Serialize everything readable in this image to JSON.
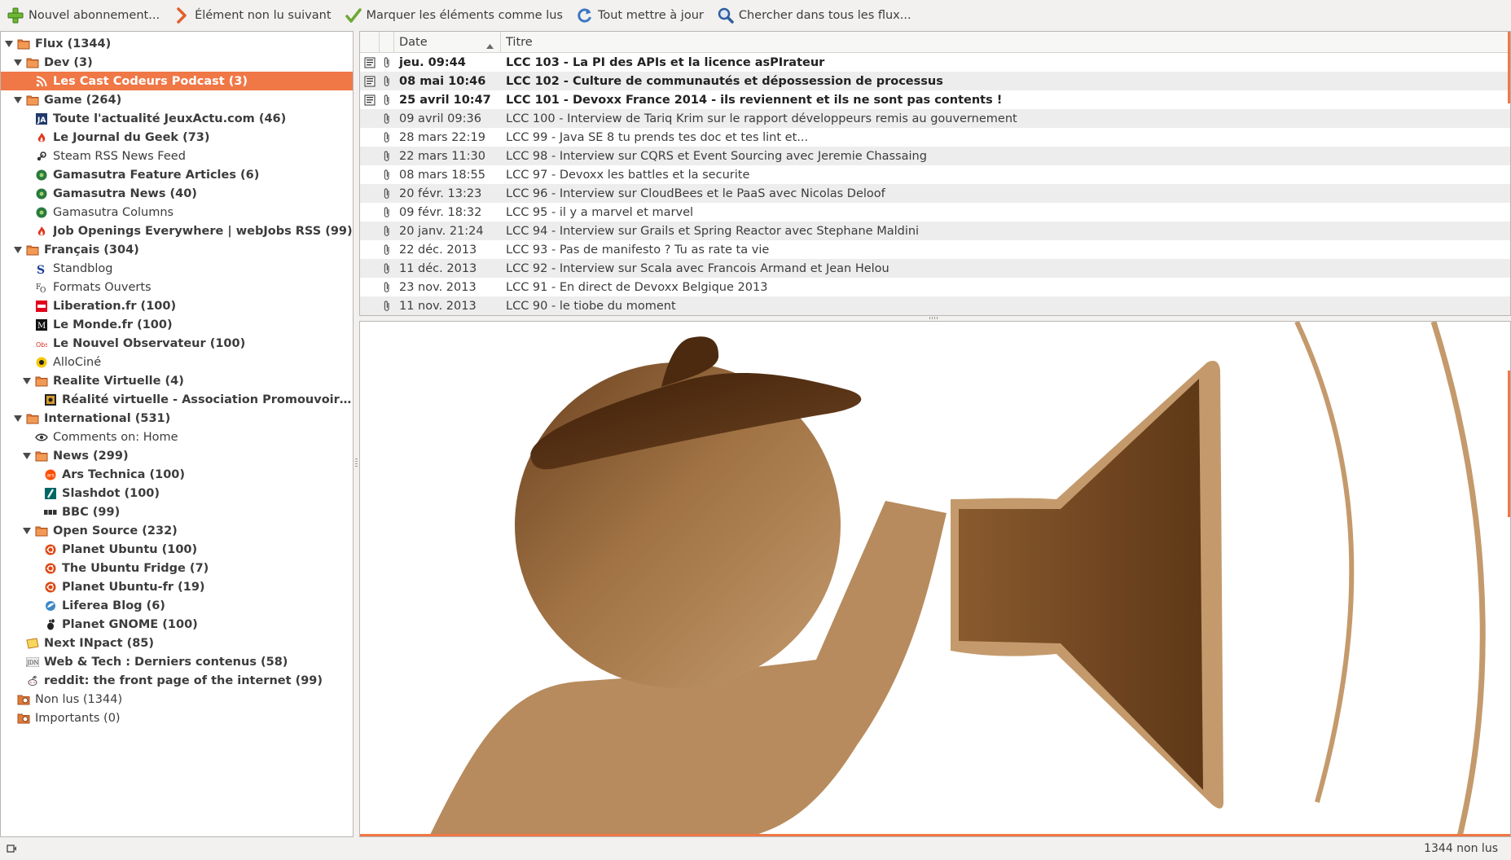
{
  "toolbar": {
    "subscribe": "Nouvel abonnement...",
    "next_unread": "Élément non lu suivant",
    "mark_read": "Marquer les éléments comme lus",
    "update_all": "Tout mettre à jour",
    "search": "Chercher dans tous les flux..."
  },
  "feeds": [
    {
      "label": "Flux (1344)",
      "level": 0,
      "type": "folder",
      "expander": "open",
      "bold": true
    },
    {
      "label": "Dev (3)",
      "level": 1,
      "type": "folder",
      "expander": "open",
      "bold": true
    },
    {
      "label": "Les Cast Codeurs Podcast (3)",
      "level": 2,
      "type": "feed",
      "icon": "rss",
      "bold": true,
      "selected": true
    },
    {
      "label": "Game (264)",
      "level": 1,
      "type": "folder",
      "expander": "open",
      "bold": true
    },
    {
      "label": "Toute l'actualité JeuxActu.com (46)",
      "level": 2,
      "type": "feed",
      "icon": "jeuxactu",
      "bold": true
    },
    {
      "label": "Le Journal du Geek (73)",
      "level": 2,
      "type": "feed",
      "icon": "flame",
      "bold": true
    },
    {
      "label": "Steam RSS News Feed",
      "level": 2,
      "type": "feed",
      "icon": "steam",
      "bold": false
    },
    {
      "label": "Gamasutra Feature Articles (6)",
      "level": 2,
      "type": "feed",
      "icon": "gamasutra",
      "bold": true
    },
    {
      "label": "Gamasutra News (40)",
      "level": 2,
      "type": "feed",
      "icon": "gamasutra",
      "bold": true
    },
    {
      "label": "Gamasutra Columns",
      "level": 2,
      "type": "feed",
      "icon": "gamasutra",
      "bold": false
    },
    {
      "label": "Job Openings Everywhere | webJobs RSS (99)",
      "level": 2,
      "type": "feed",
      "icon": "flame",
      "bold": true
    },
    {
      "label": "Français (304)",
      "level": 1,
      "type": "folder",
      "expander": "open",
      "bold": true
    },
    {
      "label": "Standblog",
      "level": 2,
      "type": "feed",
      "icon": "standblog",
      "bold": false
    },
    {
      "label": "Formats Ouverts",
      "level": 2,
      "type": "feed",
      "icon": "formats",
      "bold": false
    },
    {
      "label": "Liberation.fr (100)",
      "level": 2,
      "type": "feed",
      "icon": "liberation",
      "bold": true
    },
    {
      "label": "Le Monde.fr (100)",
      "level": 2,
      "type": "feed",
      "icon": "lemonde",
      "bold": true
    },
    {
      "label": "Le Nouvel Observateur (100)",
      "level": 2,
      "type": "feed",
      "icon": "obs",
      "bold": true
    },
    {
      "label": "AlloCiné",
      "level": 2,
      "type": "feed",
      "icon": "allocine",
      "bold": false
    },
    {
      "label": "Realite Virtuelle (4)",
      "level": 2,
      "type": "folder",
      "expander": "open",
      "bold": true
    },
    {
      "label": "Réalité virtuelle - Association Promouvoir la Réa...",
      "level": 3,
      "type": "feed",
      "icon": "vr",
      "bold": true
    },
    {
      "label": "International (531)",
      "level": 1,
      "type": "folder",
      "expander": "open",
      "bold": true
    },
    {
      "label": "Comments on: Home",
      "level": 2,
      "type": "feed",
      "icon": "eye",
      "bold": false
    },
    {
      "label": "News (299)",
      "level": 2,
      "type": "folder",
      "expander": "open",
      "bold": true
    },
    {
      "label": "Ars Technica (100)",
      "level": 3,
      "type": "feed",
      "icon": "ars",
      "bold": true
    },
    {
      "label": "Slashdot (100)",
      "level": 3,
      "type": "feed",
      "icon": "slashdot",
      "bold": true
    },
    {
      "label": "BBC (99)",
      "level": 3,
      "type": "feed",
      "icon": "bbc",
      "bold": true
    },
    {
      "label": "Open Source (232)",
      "level": 2,
      "type": "folder",
      "expander": "open",
      "bold": true
    },
    {
      "label": "Planet Ubuntu (100)",
      "level": 3,
      "type": "feed",
      "icon": "ubuntu",
      "bold": true
    },
    {
      "label": "The Ubuntu Fridge (7)",
      "level": 3,
      "type": "feed",
      "icon": "ubuntu",
      "bold": true
    },
    {
      "label": "Planet Ubuntu-fr (19)",
      "level": 3,
      "type": "feed",
      "icon": "ubuntu",
      "bold": true
    },
    {
      "label": "Liferea Blog (6)",
      "level": 3,
      "type": "feed",
      "icon": "liferea",
      "bold": true
    },
    {
      "label": "Planet GNOME (100)",
      "level": 3,
      "type": "feed",
      "icon": "gnome",
      "bold": true
    },
    {
      "label": "Next INpact (85)",
      "level": 1,
      "type": "feed",
      "icon": "nextinpact",
      "bold": true
    },
    {
      "label": "Web & Tech : Derniers contenus (58)",
      "level": 1,
      "type": "feed",
      "icon": "jdn",
      "bold": true
    },
    {
      "label": "reddit: the front page of the internet (99)",
      "level": 1,
      "type": "feed",
      "icon": "reddit",
      "bold": true
    },
    {
      "label": "Non lus (1344)",
      "level": 0,
      "type": "vfolder",
      "bold": false
    },
    {
      "label": "Importants (0)",
      "level": 0,
      "type": "vfolder",
      "bold": false
    }
  ],
  "itemlist": {
    "col_date": "Date",
    "col_title": "Titre",
    "items": [
      {
        "date": "jeu. 09:44",
        "title": "LCC 103 - La PI des APIs et la licence asPIrateur",
        "bold": true,
        "doc": true
      },
      {
        "date": "08 mai 10:46",
        "title": "LCC 102 - Culture de communautés et dépossession de processus",
        "bold": true,
        "doc": true
      },
      {
        "date": "25 avril 10:47",
        "title": "LCC 101 - Devoxx France 2014 - ils reviennent et ils ne sont pas contents !",
        "bold": true,
        "doc": true
      },
      {
        "date": "09 avril 09:36",
        "title": "LCC 100 - Interview de Tariq Krim sur le rapport développeurs remis au gouvernement",
        "bold": false,
        "doc": false
      },
      {
        "date": "28 mars 22:19",
        "title": "LCC 99 - Java SE 8 tu prends tes doc et tes lint et...",
        "bold": false,
        "doc": false
      },
      {
        "date": "22 mars 11:30",
        "title": "LCC 98 - Interview sur CQRS et Event Sourcing avec Jeremie Chassaing",
        "bold": false,
        "doc": false
      },
      {
        "date": "08 mars 18:55",
        "title": "LCC 97 - Devoxx les battles et la securite",
        "bold": false,
        "doc": false
      },
      {
        "date": "20 févr. 13:23",
        "title": "LCC 96 - Interview sur CloudBees et le PaaS avec Nicolas Deloof",
        "bold": false,
        "doc": false
      },
      {
        "date": "09 févr. 18:32",
        "title": "LCC 95 - il y a marvel et marvel",
        "bold": false,
        "doc": false
      },
      {
        "date": "20 janv. 21:24",
        "title": "LCC 94 - Interview sur Grails et Spring Reactor avec Stephane Maldini",
        "bold": false,
        "doc": false
      },
      {
        "date": "22 déc. 2013",
        "title": "LCC 93 - Pas de manifesto ? Tu as rate ta vie",
        "bold": false,
        "doc": false
      },
      {
        "date": "11 déc. 2013",
        "title": "LCC 92 - Interview sur Scala avec Francois Armand et Jean Helou",
        "bold": false,
        "doc": false
      },
      {
        "date": "23 nov. 2013",
        "title": "LCC 91 - En direct de Devoxx Belgique 2013",
        "bold": false,
        "doc": false
      },
      {
        "date": "11 nov. 2013",
        "title": "LCC 90 - le tiobe du moment",
        "bold": false,
        "doc": false
      }
    ]
  },
  "status": {
    "text": "1344 non lus"
  },
  "colors": {
    "accent": "#f07746",
    "selection": "#f07746",
    "brown_dark": "#5c3516",
    "brown_light": "#c49a6c"
  }
}
